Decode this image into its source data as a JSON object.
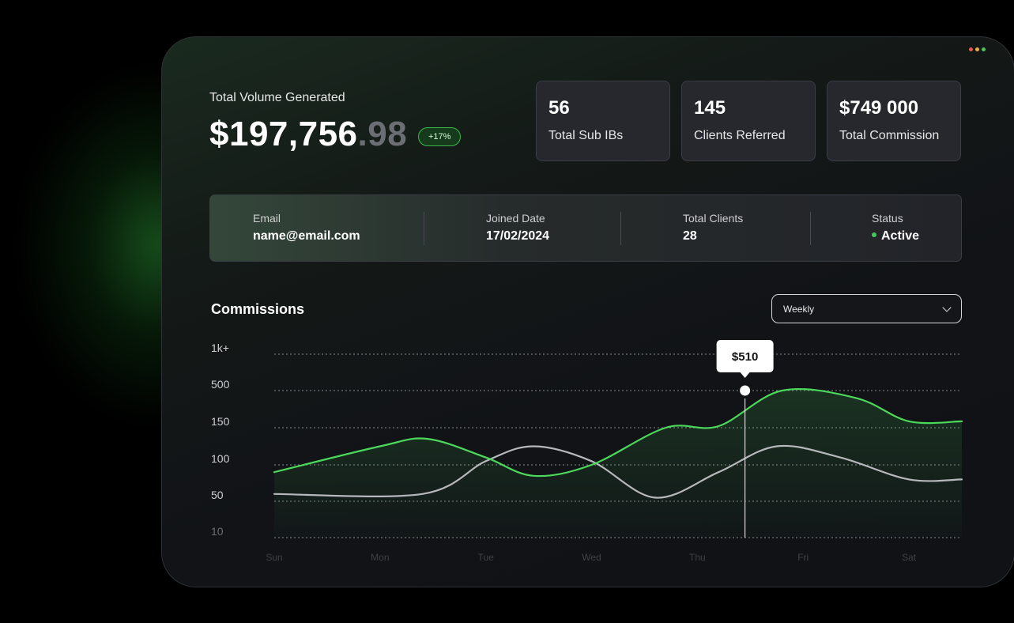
{
  "header": {
    "title": "Total Volume Generated",
    "value_main": "$197,756",
    "value_cents": ".98",
    "change_badge": "+17%"
  },
  "stats": [
    {
      "value": "56",
      "label": "Total Sub IBs"
    },
    {
      "value": "145",
      "label": "Clients Referred"
    },
    {
      "value": "$749 000",
      "label": "Total Commission"
    }
  ],
  "info": {
    "email_label": "Email",
    "email_value": "name@email.com",
    "joined_label": "Joined Date",
    "joined_value": "17/02/2024",
    "clients_label": "Total Clients",
    "clients_value": "28",
    "status_label": "Status",
    "status_value": "Active"
  },
  "commissions": {
    "title": "Commissions",
    "period": "Weekly"
  },
  "colors": {
    "accent_green": "#4cd85a",
    "secondary_line": "#b7b8bc",
    "window_dots": [
      "#e25b4f",
      "#e8b04a",
      "#4cc35a"
    ]
  },
  "chart_data": {
    "type": "line",
    "y_tick_labels": [
      "10",
      "50",
      "100",
      "150",
      "500",
      "1k+"
    ],
    "categories": [
      "Sun",
      "Mon",
      "Tue",
      "Wed",
      "Thu",
      "Fri",
      "Sat"
    ],
    "category_positions": [
      0,
      1,
      2,
      3,
      4,
      5,
      6
    ],
    "x_range": [
      0,
      6.5
    ],
    "series": [
      {
        "color": "#4cd85a",
        "points": [
          [
            0,
            90
          ],
          [
            1,
            125
          ],
          [
            1.45,
            135
          ],
          [
            2,
            110
          ],
          [
            2.45,
            85
          ],
          [
            3,
            100
          ],
          [
            3.7,
            150
          ],
          [
            4.2,
            165
          ],
          [
            4.8,
            500
          ],
          [
            5.5,
            430
          ],
          [
            6,
            210
          ],
          [
            6.5,
            210
          ]
        ]
      },
      {
        "color": "#b7b8bc",
        "points": [
          [
            0,
            60
          ],
          [
            1.4,
            60
          ],
          [
            2,
            105
          ],
          [
            2.45,
            125
          ],
          [
            3,
            105
          ],
          [
            3.6,
            55
          ],
          [
            4.2,
            90
          ],
          [
            4.75,
            125
          ],
          [
            5.35,
            110
          ],
          [
            6,
            80
          ],
          [
            6.5,
            80
          ]
        ]
      }
    ],
    "highlight": {
      "x": 4.45,
      "y": 500,
      "label": "$510"
    },
    "grid": true
  }
}
